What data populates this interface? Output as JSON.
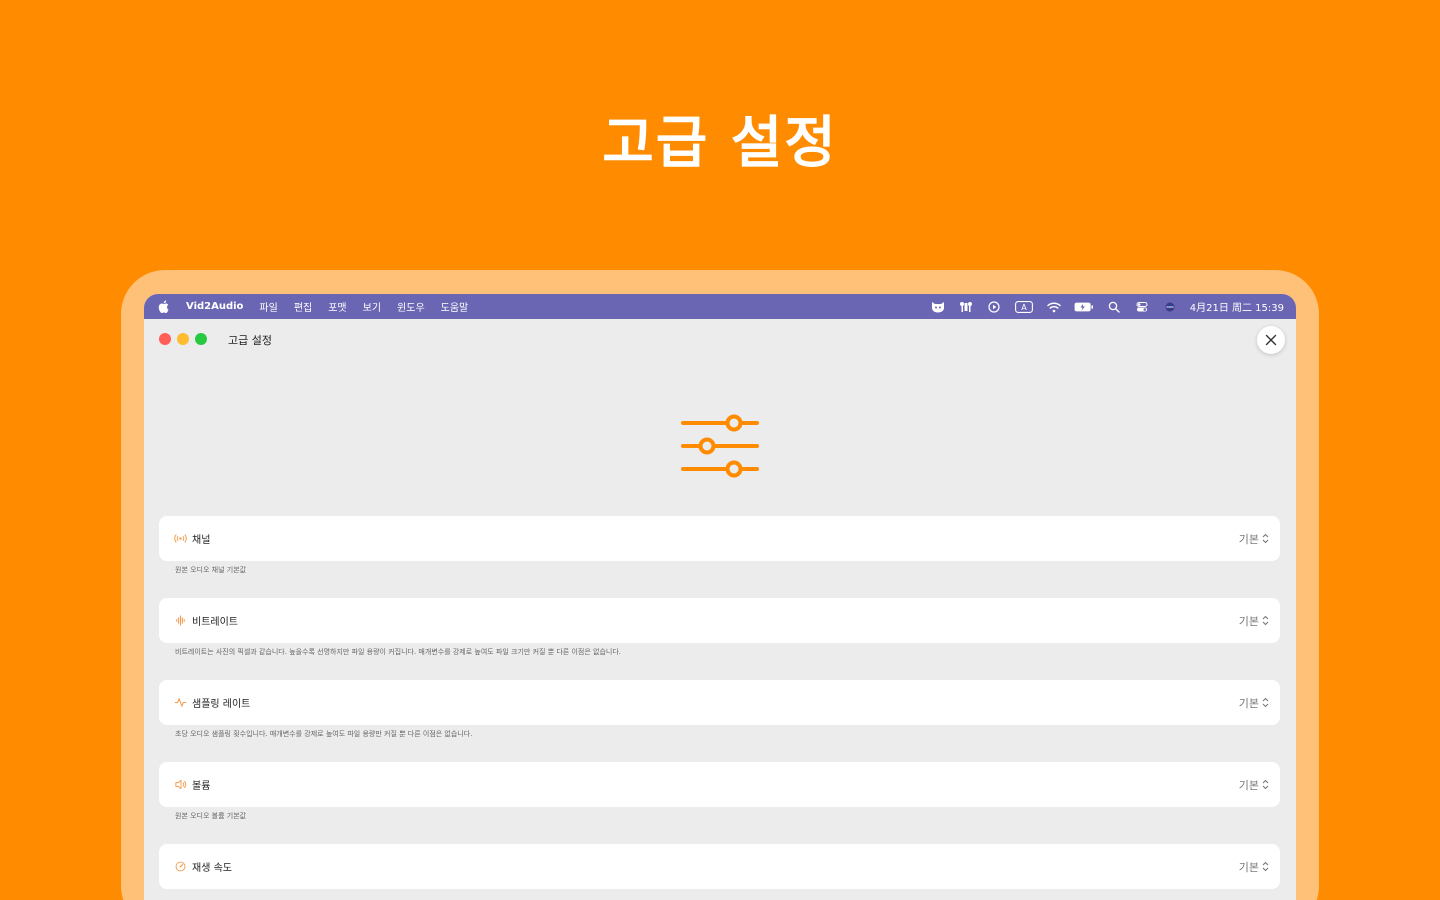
{
  "hero": {
    "title": "고급 설정"
  },
  "menubar": {
    "app_name": "Vid2Audio",
    "items": [
      "파일",
      "편집",
      "포맷",
      "보기",
      "윈도우",
      "도움말"
    ],
    "clock": "4月21日 周二 15:39",
    "status_icons": [
      "cat-icon",
      "airpods-icon",
      "play-circle-icon",
      "input-a-icon",
      "wifi-icon",
      "battery-icon",
      "search-icon",
      "control-center-icon",
      "siri-icon"
    ],
    "input_label": "A"
  },
  "window": {
    "title": "고급 설정"
  },
  "settings": [
    {
      "icon": "broadcast-icon",
      "label": "채널",
      "value": "기본",
      "description": "원본 오디오 채널 기본값"
    },
    {
      "icon": "waveform-icon",
      "label": "비트레이트",
      "value": "기본",
      "description": "비트레이트는 사진의 픽셀과 같습니다. 높을수록 선명하지만 파일 용량이 커집니다. 매개변수를 강제로 높여도 파일 크기만 커질 뿐 다른 이점은 없습니다."
    },
    {
      "icon": "pulse-icon",
      "label": "샘플링 레이트",
      "value": "기본",
      "description": "초당 오디오 샘플링 횟수입니다. 매개변수를 강제로 높여도 파일 용량만 커질 뿐 다른 이점은 없습니다."
    },
    {
      "icon": "speaker-icon",
      "label": "볼륨",
      "value": "기본",
      "description": "원본 오디오 볼륨 기본값"
    },
    {
      "icon": "speedometer-icon",
      "label": "재생 속도",
      "value": "기본",
      "description": ""
    }
  ],
  "colors": {
    "accent": "#ff8c00",
    "menubar": "#6b66b3",
    "device_frame": "#ffc078",
    "panel": "#ececec"
  }
}
